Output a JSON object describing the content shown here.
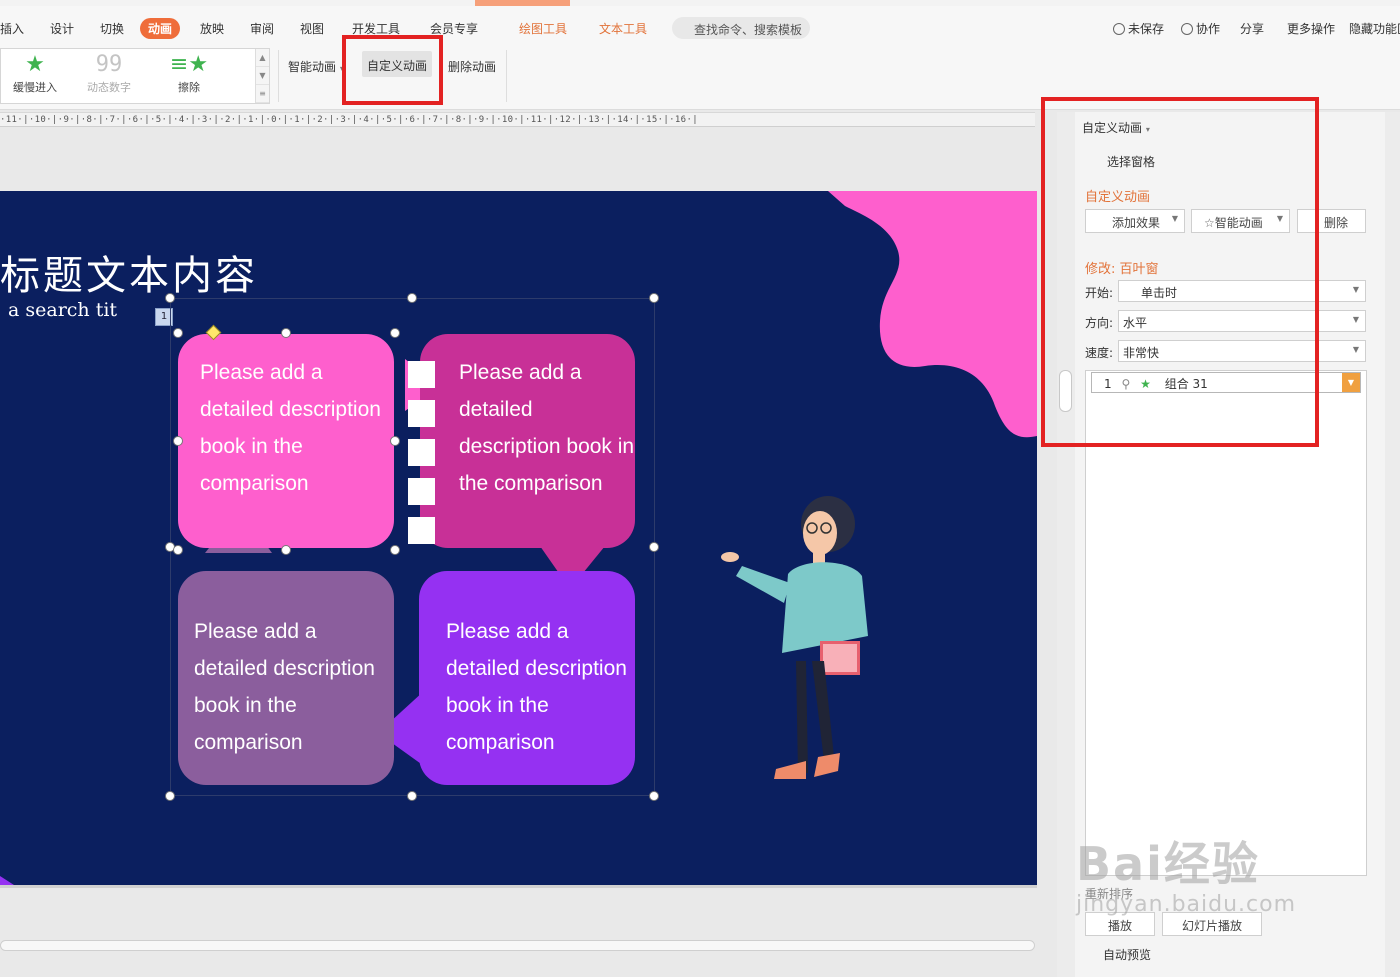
{
  "menu": {
    "tabs": [
      "插入",
      "设计",
      "切换",
      "动画",
      "放映",
      "审阅",
      "视图",
      "开发工具",
      "会员专享"
    ],
    "active_tab": "动画",
    "context_tabs": [
      "绘图工具",
      "文本工具"
    ],
    "search_placeholder": "查找命令、搜索模板",
    "right": {
      "unsaved": "未保存",
      "collab": "协作",
      "share": "分享",
      "more": "更多操作",
      "hide": "隐藏功能区"
    }
  },
  "ribbon": {
    "gallery": [
      {
        "label": "缓慢进入",
        "icon": "star-icon",
        "glyph": "★"
      },
      {
        "label": "动态数字",
        "icon": "number-icon",
        "glyph": "99"
      },
      {
        "label": "擦除",
        "icon": "wipe-icon",
        "glyph": "≡★"
      }
    ],
    "smart_animation": "智能动画",
    "custom_animation": "自定义动画",
    "delete_animation": "删除动画"
  },
  "ruler_text": "·11·|·10·|·9·|·8·|·7·|·6·|·5·|·4·|·3·|·2·|·1·|·0·|·1·|·2·|·3·|·4·|·5·|·6·|·7·|·8·|·9·|·10·|·11·|·12·|·13·|·14·|·15·|·16·|",
  "slide": {
    "title": "标题文本内容",
    "subtitle": "a search tit",
    "anim_tag": "1",
    "bubbles": [
      "Please add a detailed description book in the comparison",
      "Please add a detailed description book in the comparison",
      "Please add a detailed description book in the comparison",
      "Please add a detailed description book in the comparison"
    ],
    "colors": {
      "background": "#0b1f5f",
      "pink": "#fe5fcd",
      "magenta": "#c83097",
      "violet": "#8b5e9d",
      "purple": "#9531f2"
    }
  },
  "panel": {
    "header": "自定义动画",
    "select_pane": "选择窗格",
    "section_title": "自定义动画",
    "add_effect": "添加效果",
    "smart_animation": "智能动画",
    "delete": "删除",
    "modify": "修改: 百叶窗",
    "start_label": "开始:",
    "start_value": "单击时",
    "direction_label": "方向:",
    "direction_value": "水平",
    "speed_label": "速度:",
    "speed_value": "非常快",
    "list_item": {
      "index": "1",
      "name": "组合 31"
    },
    "reorder": "重新排序",
    "play": "播放",
    "slideshow": "幻灯片播放",
    "auto_preview": "自动预览"
  },
  "watermark": {
    "brand": "Bai经验",
    "url": "jingyan.baidu.com"
  }
}
